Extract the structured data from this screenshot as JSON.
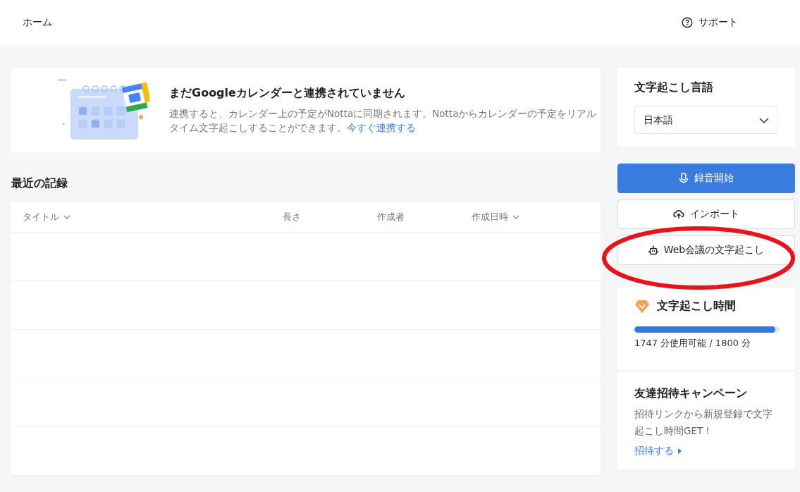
{
  "header": {
    "home": "ホーム",
    "support": "サポート"
  },
  "calendar_banner": {
    "title": "まだGoogleカレンダーと連携されていません",
    "text": "連携すると、カレンダー上の予定がNottaに同期されます。Nottaからカレンダーの予定をリアルタイム文字起こしすることができます。",
    "link": "今すぐ連携する"
  },
  "recent": {
    "title": "最近の記録",
    "columns": [
      {
        "label": "タイトル",
        "sortable": true
      },
      {
        "label": "長さ",
        "sortable": false
      },
      {
        "label": "作成者",
        "sortable": false
      },
      {
        "label": "作成日時",
        "sortable": true
      }
    ]
  },
  "language": {
    "title": "文字起こし言語",
    "value": "日本語"
  },
  "actions": [
    {
      "label": "録音開始",
      "kind": "record",
      "primary": true,
      "highlighted": false
    },
    {
      "label": "インポート",
      "kind": "import",
      "primary": false,
      "highlighted": false
    },
    {
      "label": "Web会議の文字起こし",
      "kind": "meeting",
      "primary": false,
      "highlighted": true
    }
  ],
  "minutes": {
    "title": "文字起こし時間",
    "level": 0.97,
    "reading": "1747 分使用可能 / 1800 分"
  },
  "invite": {
    "title": "友達招待キャンペーン",
    "text": "招待リンクから新規登録で文字起こし時間GET！",
    "link": "招待する"
  }
}
